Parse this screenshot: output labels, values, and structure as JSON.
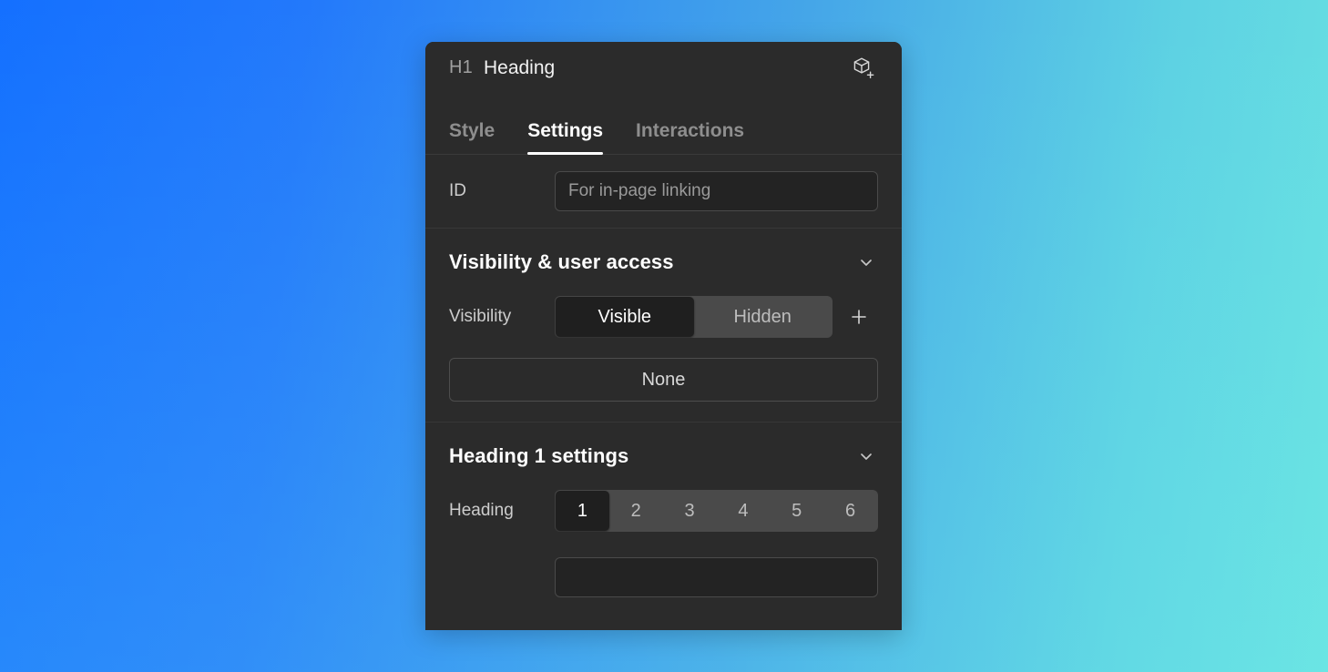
{
  "background": {
    "gradient_from": "#1470FF",
    "gradient_to": "#68E0E2"
  },
  "panel": {
    "header": {
      "tag": "H1",
      "element_name": "Heading",
      "create_component_icon": "cube-plus-icon"
    },
    "tabs": [
      {
        "label": "Style",
        "active": false
      },
      {
        "label": "Settings",
        "active": true
      },
      {
        "label": "Interactions",
        "active": false
      }
    ],
    "id_section": {
      "label": "ID",
      "value": "",
      "placeholder": "For in-page linking"
    },
    "visibility_section": {
      "title": "Visibility & user access",
      "collapse_icon": "chevron-down-icon",
      "visibility_label": "Visibility",
      "options": [
        {
          "label": "Visible",
          "selected": true
        },
        {
          "label": "Hidden",
          "selected": false
        }
      ],
      "add_condition_icon": "plus-icon",
      "access_button_label": "None"
    },
    "heading_section": {
      "title": "Heading 1 settings",
      "collapse_icon": "chevron-down-icon",
      "heading_label": "Heading",
      "levels": [
        {
          "label": "1",
          "selected": true
        },
        {
          "label": "2",
          "selected": false
        },
        {
          "label": "3",
          "selected": false
        },
        {
          "label": "4",
          "selected": false
        },
        {
          "label": "5",
          "selected": false
        },
        {
          "label": "6",
          "selected": false
        }
      ]
    }
  }
}
